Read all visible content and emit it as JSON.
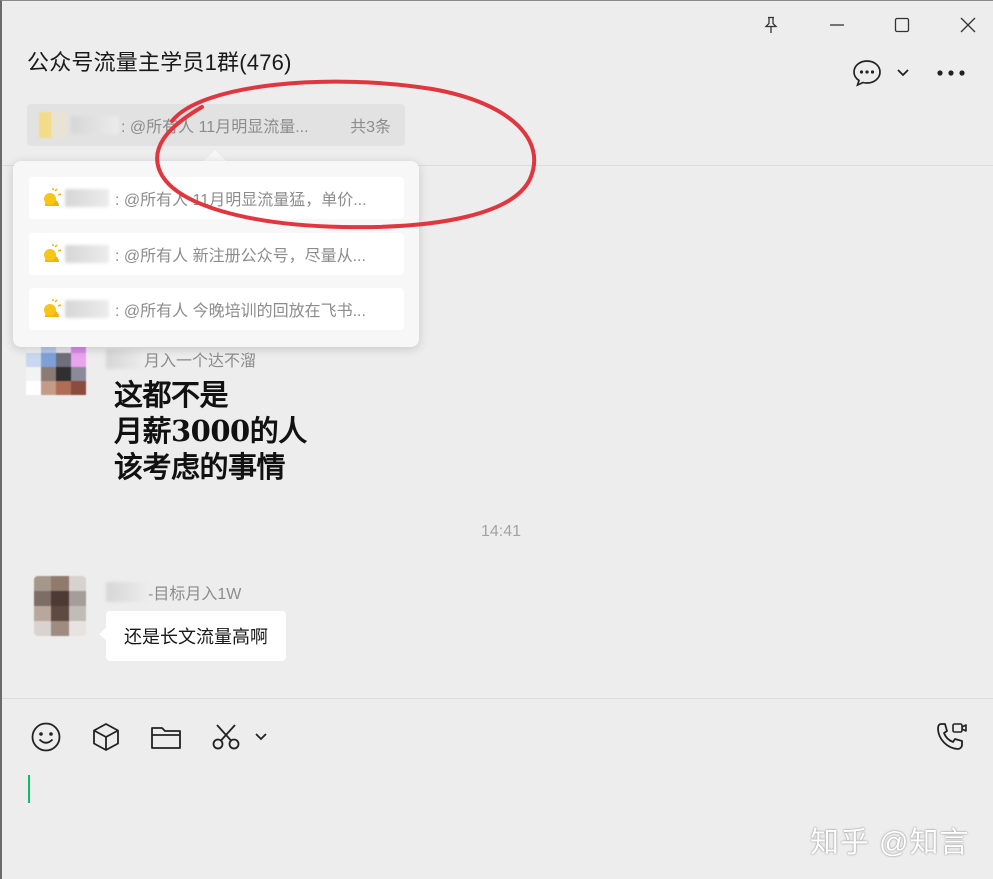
{
  "window": {
    "title": "公众号流量主学员1群(476)",
    "controls": [
      "pin-icon",
      "minimize-icon",
      "maximize-icon",
      "close-icon"
    ]
  },
  "header": {
    "chat_info_icon": "chat-bubble-icon",
    "dropdown_icon": "chevron-down-icon",
    "more_icon": "more-icon"
  },
  "pinned": {
    "preview": ": @所有人 11月明显流量...",
    "count": "共3条"
  },
  "popup": {
    "items": [
      {
        "icon": "sun-icon",
        "text": ": @所有人 11月明显流量猛，单价..."
      },
      {
        "icon": "sun-icon",
        "text": ": @所有人 新注册公众号，尽量从..."
      },
      {
        "icon": "sun-icon",
        "text": ": @所有人 今晚培训的回放在飞书..."
      }
    ]
  },
  "messages": [
    {
      "sender_suffix": "月入一个达不溜",
      "image_text": [
        "这都不是",
        "月薪3000的人",
        "该考虑的事情"
      ]
    },
    {
      "timestamp": "14:41"
    },
    {
      "sender_suffix": "-目标月入1W",
      "text": "还是长文流量高啊"
    }
  ],
  "toolbar": {
    "icons": [
      "emoji-icon",
      "sticker-box-icon",
      "folder-icon",
      "scissors-icon",
      "chevron-down-icon",
      "voice-video-call-icon"
    ]
  },
  "watermark": "知乎 @知言",
  "colors": {
    "accent_green": "#07c160",
    "annotation_red": "#e0363f",
    "background": "#ededed"
  }
}
